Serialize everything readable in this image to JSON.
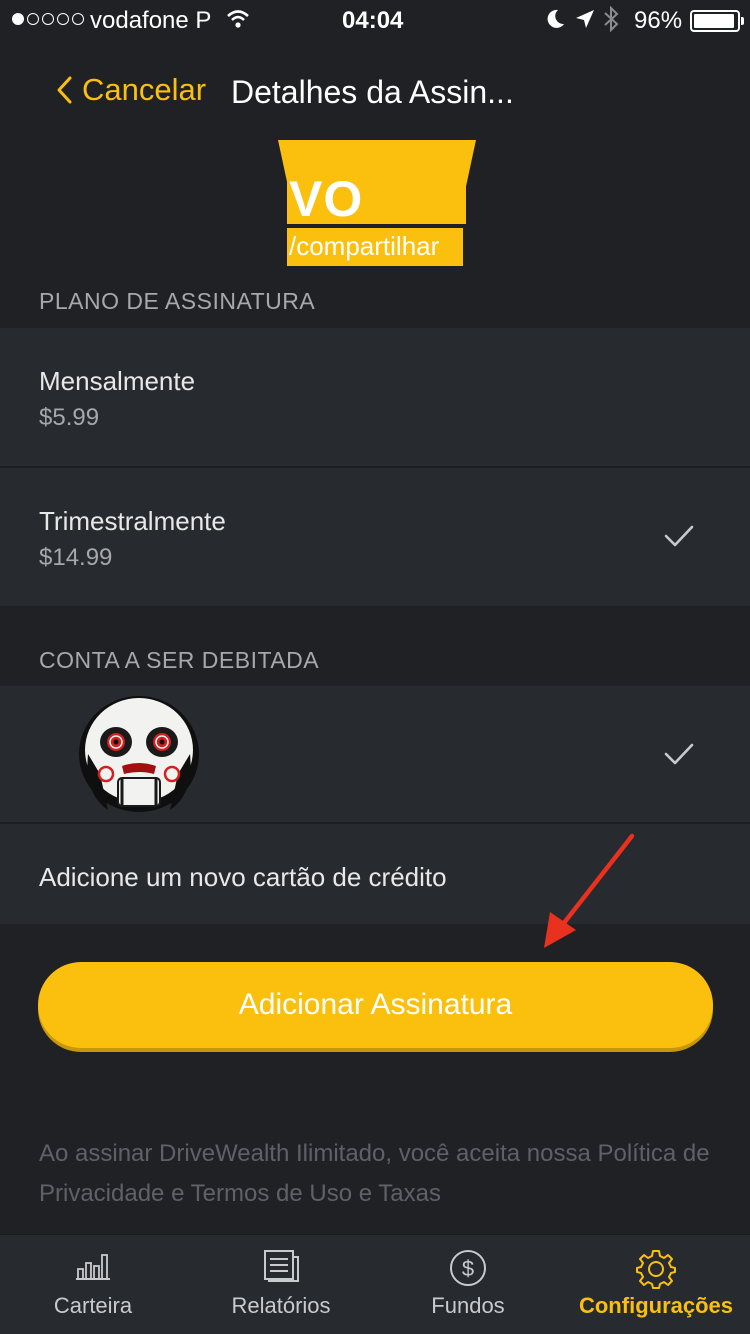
{
  "status_bar": {
    "carrier": "vodafone P",
    "time": "04:04",
    "battery": "96%",
    "battery_level": 0.96,
    "signal_bars_filled": 1,
    "signal_bars_total": 5
  },
  "nav": {
    "back_label": "Cancelar",
    "title": "Detalhes da Assin..."
  },
  "logo": {
    "text": "VO",
    "subtext": "/compartilhar"
  },
  "subscription_plan": {
    "header": "PLANO DE ASSINATURA",
    "options": [
      {
        "title": "Mensalmente",
        "price": "$5.99",
        "selected": false
      },
      {
        "title": "Trimestralmente",
        "price": "$14.99",
        "selected": true
      }
    ]
  },
  "debit_account": {
    "header": "CONTA A SER DEBITADA",
    "add_card_label": "Adicione um novo cartão de crédito"
  },
  "actions": {
    "subscribe_label": "Adicionar Assinatura"
  },
  "footer": {
    "note": "Ao assinar DriveWealth Ilimitado, você aceita nossa Política de Privacidade e Termos de Uso e Taxas"
  },
  "tabs": [
    {
      "label": "Carteira",
      "icon": "bar-chart-icon",
      "active": false
    },
    {
      "label": "Relatórios",
      "icon": "document-icon",
      "active": false
    },
    {
      "label": "Fundos",
      "icon": "dollar-circle-icon",
      "active": false
    },
    {
      "label": "Configurações",
      "icon": "gear-icon",
      "active": true
    }
  ],
  "colors": {
    "accent": "#fbbf0e",
    "background": "#1f2124",
    "cell": "#272a2e",
    "annotation": "#e8321f"
  }
}
